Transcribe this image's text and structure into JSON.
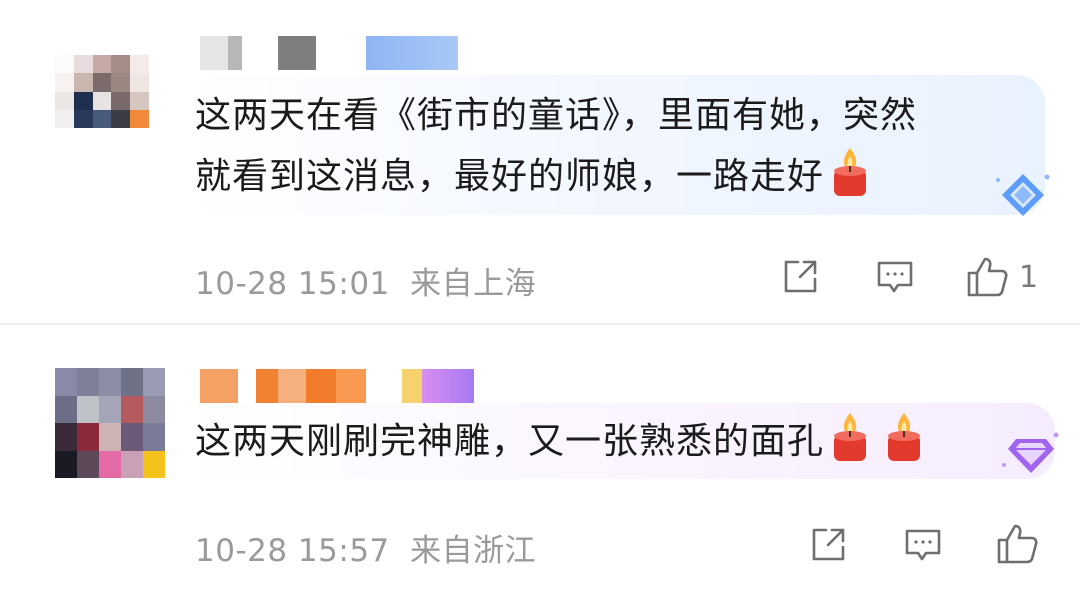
{
  "comments": [
    {
      "text_line1": "这两天在看《街市的童话》，里面有她，突然",
      "text_line2": "就看到这消息，最好的师娘，一路走好",
      "timestamp": "10-28 15:01",
      "location": "来自上海",
      "like_count": "1",
      "emoji": "candle",
      "badge_color": "#4a8cf7"
    },
    {
      "text_line1": "这两天刚刷完神雕，又一张熟悉的面孔",
      "timestamp": "10-28 15:57",
      "location": "来自浙江",
      "like_count": "",
      "emoji": "candle",
      "badge_color": "#9a55e6"
    }
  ],
  "icons": {
    "repost": "share-edit-icon",
    "comment": "comment-icon",
    "like": "thumbs-up-icon"
  },
  "colors": {
    "meta_text": "#9a9a9a",
    "body_text": "#1b1b1b"
  }
}
